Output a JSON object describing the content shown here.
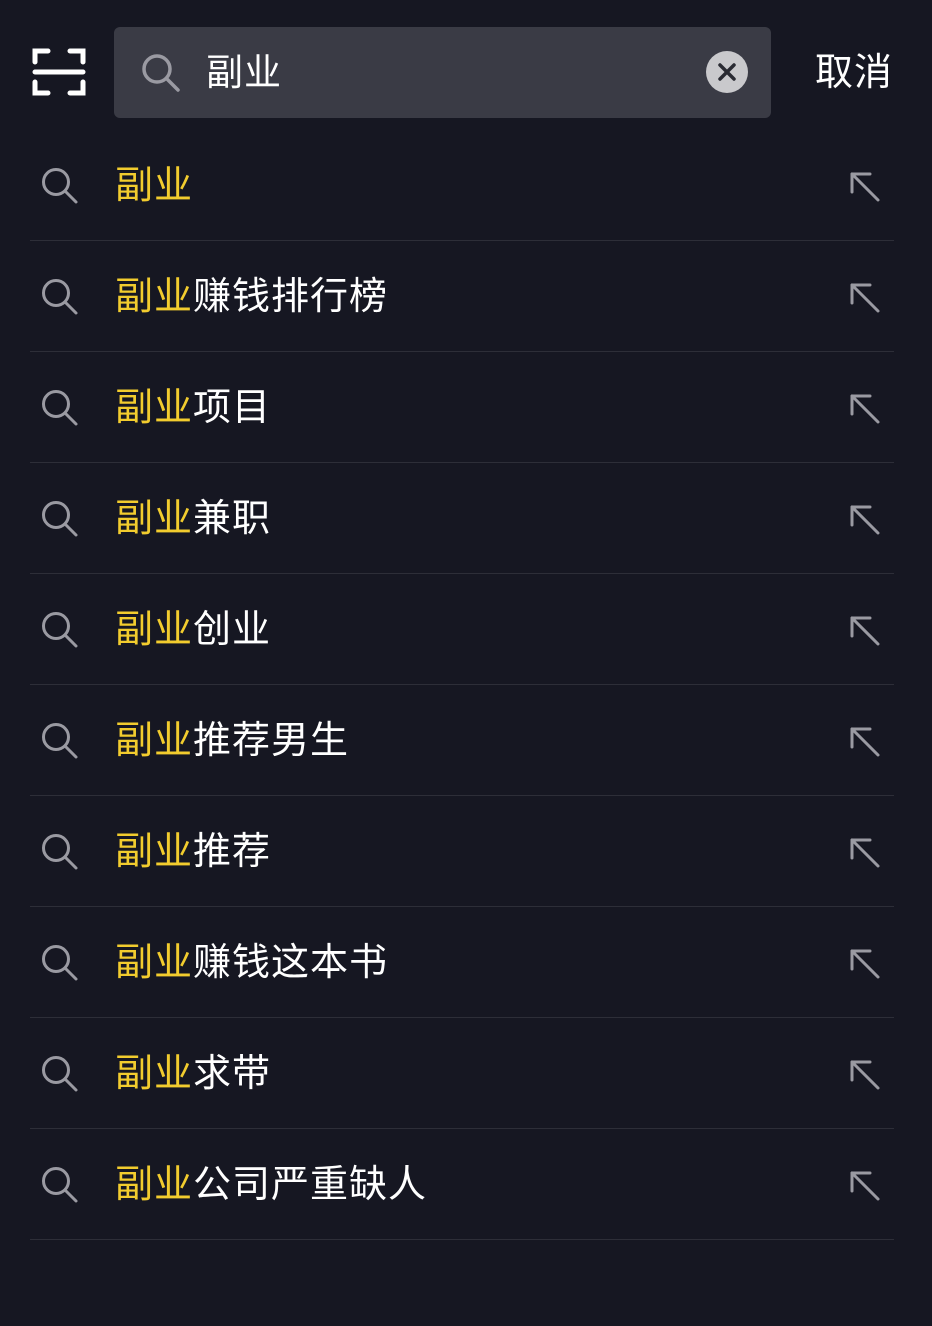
{
  "search": {
    "value": "副业",
    "cancel_label": "取消"
  },
  "suggestions": [
    {
      "highlight": "副业",
      "rest": ""
    },
    {
      "highlight": "副业",
      "rest": "赚钱排行榜"
    },
    {
      "highlight": "副业",
      "rest": "项目"
    },
    {
      "highlight": "副业",
      "rest": "兼职"
    },
    {
      "highlight": "副业",
      "rest": "创业"
    },
    {
      "highlight": "副业",
      "rest": "推荐男生"
    },
    {
      "highlight": "副业",
      "rest": "推荐"
    },
    {
      "highlight": "副业",
      "rest": "赚钱这本书"
    },
    {
      "highlight": "副业",
      "rest": "求带"
    },
    {
      "highlight": "副业",
      "rest": "公司严重缺人"
    }
  ],
  "colors": {
    "background": "#161722",
    "search_box": "#3a3b45",
    "highlight": "#f2cc2e",
    "text": "#ffffff",
    "icon": "#9a9aa2",
    "divider": "#2d2e38"
  },
  "icons": {
    "scan": "scan-icon",
    "search": "search-icon",
    "clear": "close-icon",
    "fill_query": "arrow-up-left-icon"
  }
}
